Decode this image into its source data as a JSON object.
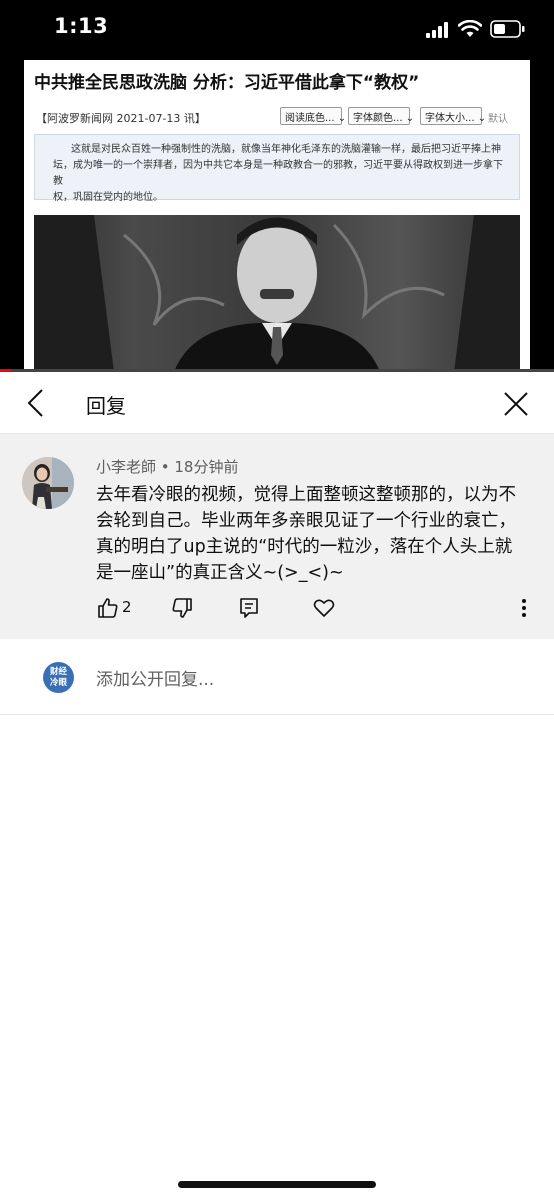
{
  "status_bar": {
    "time": "1:13"
  },
  "video": {
    "article_title": "中共推全民思政洗脑 分析：习近平借此拿下“教权”",
    "article_meta": "【阿波罗新闻网 2021-07-13 讯】",
    "select_labels": [
      "阅读底色...",
      "字体颜色...",
      "字体大小..."
    ],
    "default_label": "默认",
    "summary_lines": [
      "这就是对民众百姓一种强制性的洗脑，就像当年神化毛泽东的洗脑灌输一样，最后把习近平捧上神",
      "坛，成为唯一的一个崇拜者，因为中共它本身是一种政教合一的邪教，习近平要从得政权到进一步拿下教",
      "权，巩固在党内的地位。"
    ],
    "progress_fraction": 0.02,
    "progress_color": "#ff0000"
  },
  "reply_header": {
    "title": "回复",
    "back_icon": "chevron-left-icon",
    "close_icon": "close-icon"
  },
  "comment": {
    "author": "小李老師 • 18分钟前",
    "text": "去年看冷眼的视频，觉得上面整顿这整顿那的，以为不会轮到自己。毕业两年多亲眼见证了一个行业的衰亡，真的明白了up主说的“时代的一粒沙，落在个人头上就是一座山”的真正含义~(>_<)~",
    "like_count": "2"
  },
  "add_reply": {
    "avatar_text_line1": "财经",
    "avatar_text_line2": "冷眼",
    "avatar_color": "#3a6fb5",
    "placeholder": "添加公开回复..."
  }
}
